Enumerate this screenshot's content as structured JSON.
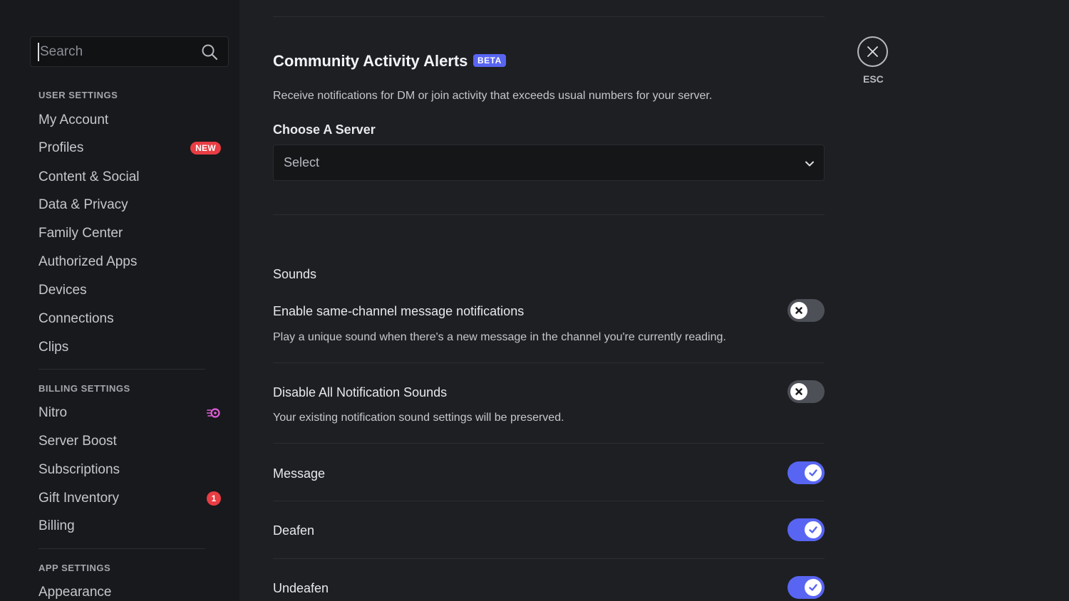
{
  "sidebar": {
    "search": {
      "placeholder": "Search",
      "value": ""
    },
    "sections": [
      {
        "header": "USER SETTINGS",
        "items": [
          {
            "label": "My Account"
          },
          {
            "label": "Profiles",
            "badge": "NEW"
          },
          {
            "label": "Content & Social"
          },
          {
            "label": "Data & Privacy"
          },
          {
            "label": "Family Center"
          },
          {
            "label": "Authorized Apps"
          },
          {
            "label": "Devices"
          },
          {
            "label": "Connections"
          },
          {
            "label": "Clips"
          }
        ]
      },
      {
        "header": "BILLING SETTINGS",
        "items": [
          {
            "label": "Nitro",
            "icon": "nitro-icon"
          },
          {
            "label": "Server Boost"
          },
          {
            "label": "Subscriptions"
          },
          {
            "label": "Gift Inventory",
            "badge": "1"
          },
          {
            "label": "Billing"
          }
        ]
      },
      {
        "header": "APP SETTINGS",
        "items": [
          {
            "label": "Appearance"
          }
        ]
      }
    ]
  },
  "main": {
    "community": {
      "title": "Community Activity Alerts",
      "badge": "BETA",
      "description": "Receive notifications for DM or join activity that exceeds usual numbers for your server.",
      "server_label": "Choose A Server",
      "select_value": "Select"
    },
    "sounds": {
      "header": "Sounds",
      "settings": [
        {
          "title": "Enable same-channel message notifications",
          "description": "Play a unique sound when there's a new message in the channel you're currently reading.",
          "enabled": false
        },
        {
          "title": "Disable All Notification Sounds",
          "description": "Your existing notification sound settings will be preserved.",
          "enabled": false
        },
        {
          "title": "Message",
          "enabled": true
        },
        {
          "title": "Deafen",
          "enabled": true
        },
        {
          "title": "Undeafen",
          "enabled": true
        }
      ]
    }
  },
  "close": {
    "label": "ESC"
  },
  "colors": {
    "accent": "#5865f2",
    "badge_red": "#e83d43",
    "toggle_off": "#4e5058",
    "sidebar_bg": "#18191c",
    "main_bg": "#1e1f22"
  }
}
